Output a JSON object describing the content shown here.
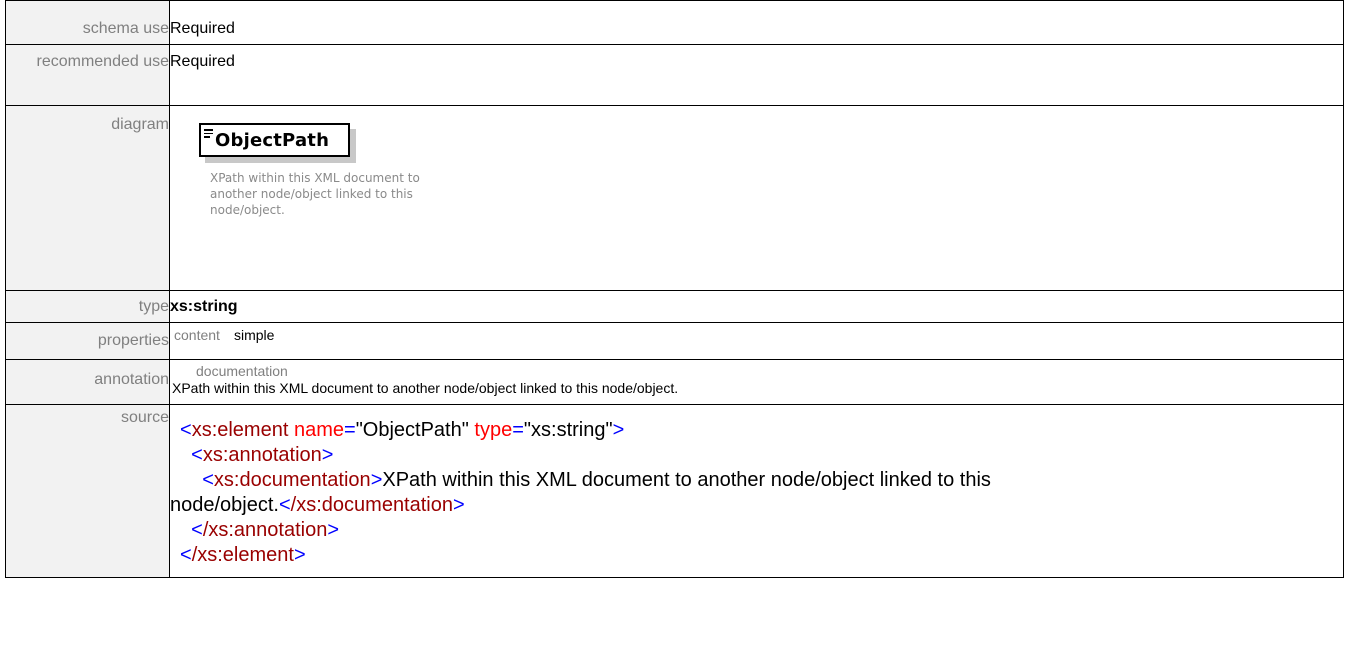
{
  "rows": {
    "schema_use": {
      "label": "schema use",
      "value": "Required"
    },
    "recommended_use": {
      "label": "recommended use",
      "value": "Required"
    },
    "diagram": {
      "label": "diagram",
      "element_name": "ObjectPath",
      "note": "XPath within this XML document to another node/object linked to this node/object."
    },
    "type": {
      "label": "type",
      "value": "xs:string"
    },
    "properties": {
      "label": "properties",
      "key": "content",
      "value": "simple"
    },
    "annotation": {
      "label": "annotation",
      "key": "documentation",
      "text": "XPath within this XML document to another node/object linked to this node/object."
    },
    "source": {
      "label": "source",
      "open_element_tag": "xs:element",
      "attr_name": "name",
      "attr_name_value": "\"ObjectPath\"",
      "attr_type": "type",
      "attr_type_value": "\"xs:string\"",
      "annotation_tag": "xs:annotation",
      "documentation_tag": "xs:documentation",
      "documentation_text_1": "XPath within this XML document to another node/object linked to this",
      "documentation_text_2": "node/object.",
      "close_documentation_tag": "/xs:documentation",
      "close_annotation_tag": "/xs:annotation",
      "close_element_tag": "/xs:element"
    }
  },
  "colors": {
    "label_bg": "#f2f2f2",
    "label_text": "#808080",
    "bracket": "#0000ff",
    "tag": "#990000",
    "attr": "#ff0000"
  },
  "icons": {
    "element_marker": "element-lines-icon"
  }
}
